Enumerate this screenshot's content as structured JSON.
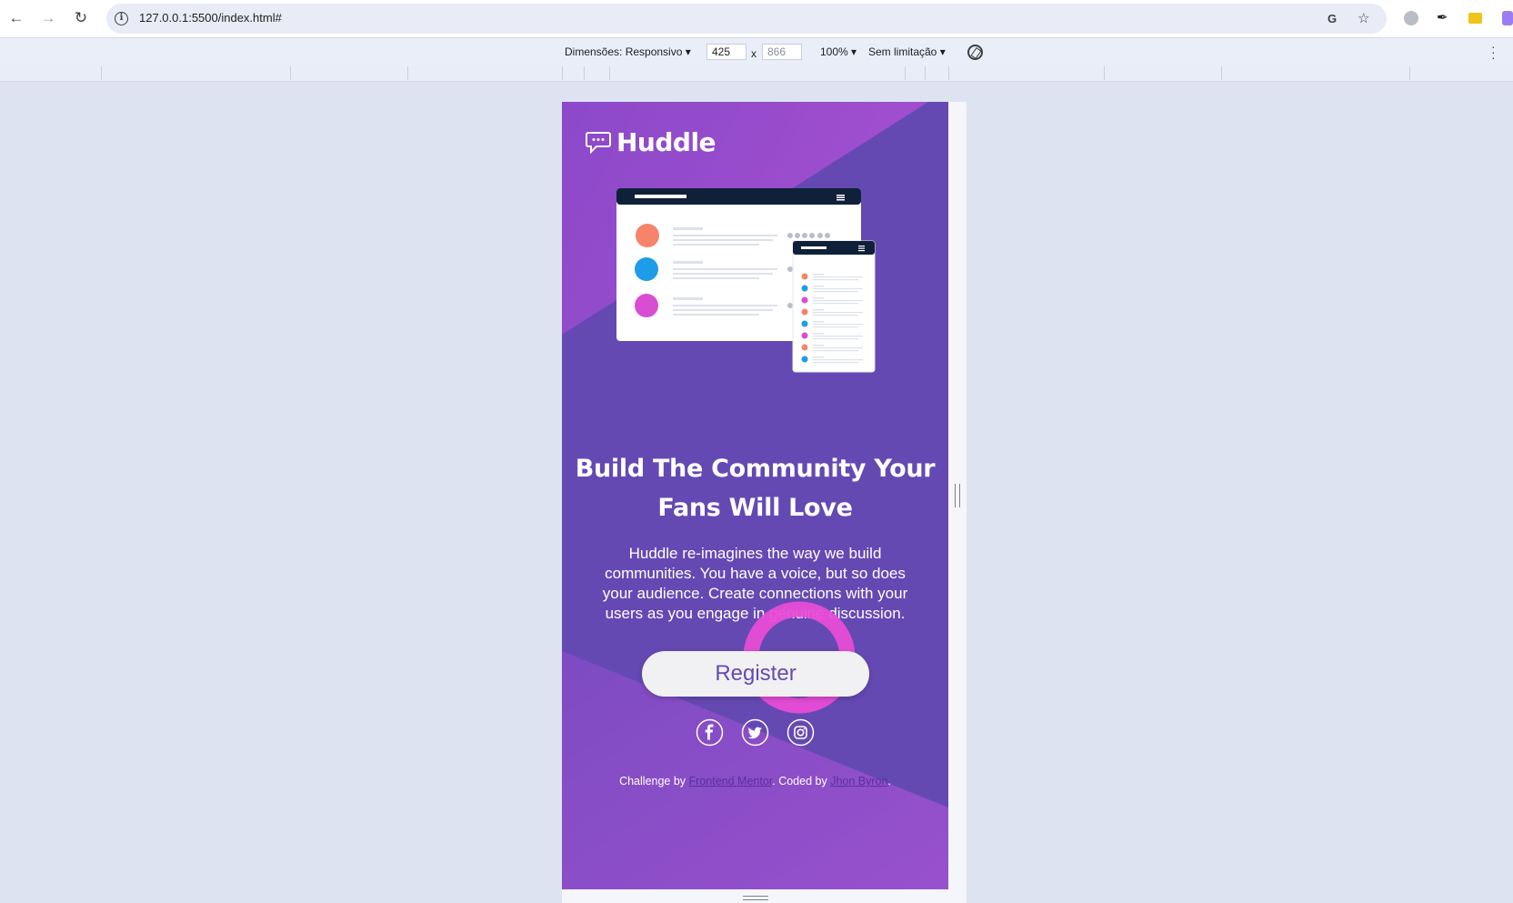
{
  "browser": {
    "url": "127.0.0.1:5500/index.html#",
    "back_icon": "arrow-left-icon",
    "forward_icon": "arrow-right-icon",
    "reload_icon": "reload-icon"
  },
  "devtools": {
    "dimensions_label": "Dimensões: Responsivo",
    "width_value": "425",
    "times": "x",
    "height_value": "866",
    "zoom": "100%",
    "throttle": "Sem limitação"
  },
  "page": {
    "logo": "Huddle",
    "title": "Build The Community Your Fans Will Love",
    "description": "Huddle re-imagines the way we build communities. You have a voice, but so does your audience. Create connections with your users as you engage in genuine discussion.",
    "register_label": "Register",
    "credits": {
      "prefix": "Challenge by ",
      "link1": "Frontend Mentor",
      "middle": ". Coded by ",
      "link2": "Jhon Byron",
      "suffix": "."
    },
    "social": [
      "facebook-icon",
      "twitter-icon",
      "instagram-icon"
    ]
  },
  "colors": {
    "violet": "#6549b3",
    "magenta": "#c35ad6",
    "pink": "#e84dd6",
    "white": "#ffffff"
  }
}
